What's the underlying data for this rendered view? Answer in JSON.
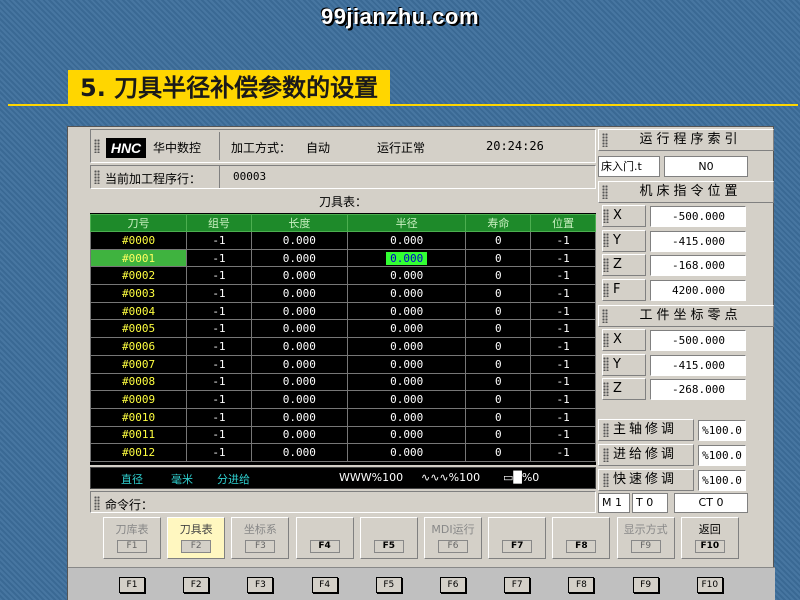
{
  "watermark": "99jianzhu.com",
  "slide_title": "5. 刀具半径补偿参数的设置",
  "header": {
    "logo": "HNC",
    "brand": "华中数控",
    "mode_label": "加工方式：",
    "mode_value": "自动",
    "run_status": "运行正常",
    "time": "20:24:26",
    "program_line_label": "当前加工程序行：",
    "program_line_value": "00003"
  },
  "tool_table": {
    "title": "刀具表：",
    "columns": [
      "刀号",
      "组号",
      "长度",
      "半径",
      "寿命",
      "位置"
    ],
    "rows": [
      [
        "#0000",
        "-1",
        "0.000",
        "0.000",
        "0",
        "-1"
      ],
      [
        "#0001",
        "-1",
        "0.000",
        "0.000",
        "0",
        "-1"
      ],
      [
        "#0002",
        "-1",
        "0.000",
        "0.000",
        "0",
        "-1"
      ],
      [
        "#0003",
        "-1",
        "0.000",
        "0.000",
        "0",
        "-1"
      ],
      [
        "#0004",
        "-1",
        "0.000",
        "0.000",
        "0",
        "-1"
      ],
      [
        "#0005",
        "-1",
        "0.000",
        "0.000",
        "0",
        "-1"
      ],
      [
        "#0006",
        "-1",
        "0.000",
        "0.000",
        "0",
        "-1"
      ],
      [
        "#0007",
        "-1",
        "0.000",
        "0.000",
        "0",
        "-1"
      ],
      [
        "#0008",
        "-1",
        "0.000",
        "0.000",
        "0",
        "-1"
      ],
      [
        "#0009",
        "-1",
        "0.000",
        "0.000",
        "0",
        "-1"
      ],
      [
        "#0010",
        "-1",
        "0.000",
        "0.000",
        "0",
        "-1"
      ],
      [
        "#0011",
        "-1",
        "0.000",
        "0.000",
        "0",
        "-1"
      ],
      [
        "#0012",
        "-1",
        "0.000",
        "0.000",
        "0",
        "-1"
      ]
    ],
    "selected_row_index": 1,
    "editing_cell": {
      "row": 1,
      "col": 3
    }
  },
  "status_bar": {
    "diameter": "直径",
    "unit": "毫米",
    "feed_mode": "分进给",
    "feed_override": "WWW%100",
    "spindle_override": "∿∿∿%100",
    "rapid_override": "▭█%0"
  },
  "command_label": "命令行：",
  "right_panel": {
    "program_index_title": "运行程序索引",
    "program_name": "床入门.t",
    "program_number": "N0",
    "machine_pos_title": "机床指令位置",
    "machine_pos": [
      {
        "axis": "X",
        "value": "-500.000"
      },
      {
        "axis": "Y",
        "value": "-415.000"
      },
      {
        "axis": "Z",
        "value": "-168.000"
      },
      {
        "axis": "F",
        "value": "4200.000"
      }
    ],
    "work_zero_title": "工件坐标零点",
    "work_zero": [
      {
        "axis": "X",
        "value": "-500.000"
      },
      {
        "axis": "Y",
        "value": "-415.000"
      },
      {
        "axis": "Z",
        "value": "-268.000"
      }
    ],
    "overrides": [
      {
        "label": "主轴修调",
        "value": "%100.0"
      },
      {
        "label": "进给修调",
        "value": "%100.0"
      },
      {
        "label": "快速修调",
        "value": "%100.0"
      }
    ],
    "status_m": "M 1",
    "status_t": "T 0",
    "status_ct": "CT 0"
  },
  "softkeys": [
    {
      "label": "刀库表",
      "key": "F1"
    },
    {
      "label": "刀具表",
      "key": "F2"
    },
    {
      "label": "坐标系",
      "key": "F3"
    },
    {
      "label": "",
      "key": "F4"
    },
    {
      "label": "",
      "key": "F5"
    },
    {
      "label": "MDI运行",
      "key": "F6"
    },
    {
      "label": "",
      "key": "F7"
    },
    {
      "label": "",
      "key": "F8"
    },
    {
      "label": "显示方式",
      "key": "F9"
    },
    {
      "label": "返回",
      "key": "F10"
    }
  ],
  "function_keys": [
    "F1",
    "F2",
    "F3",
    "F4",
    "F5",
    "F6",
    "F7",
    "F8",
    "F9",
    "F10"
  ],
  "colors": {
    "table_header_bg": "#1e8a2a",
    "selected_tool_bg": "#3fb33f",
    "tool_number_text": "#ffff40",
    "slide_title_bg": "#ffd600",
    "slide_bg": "#3d6f9c"
  }
}
